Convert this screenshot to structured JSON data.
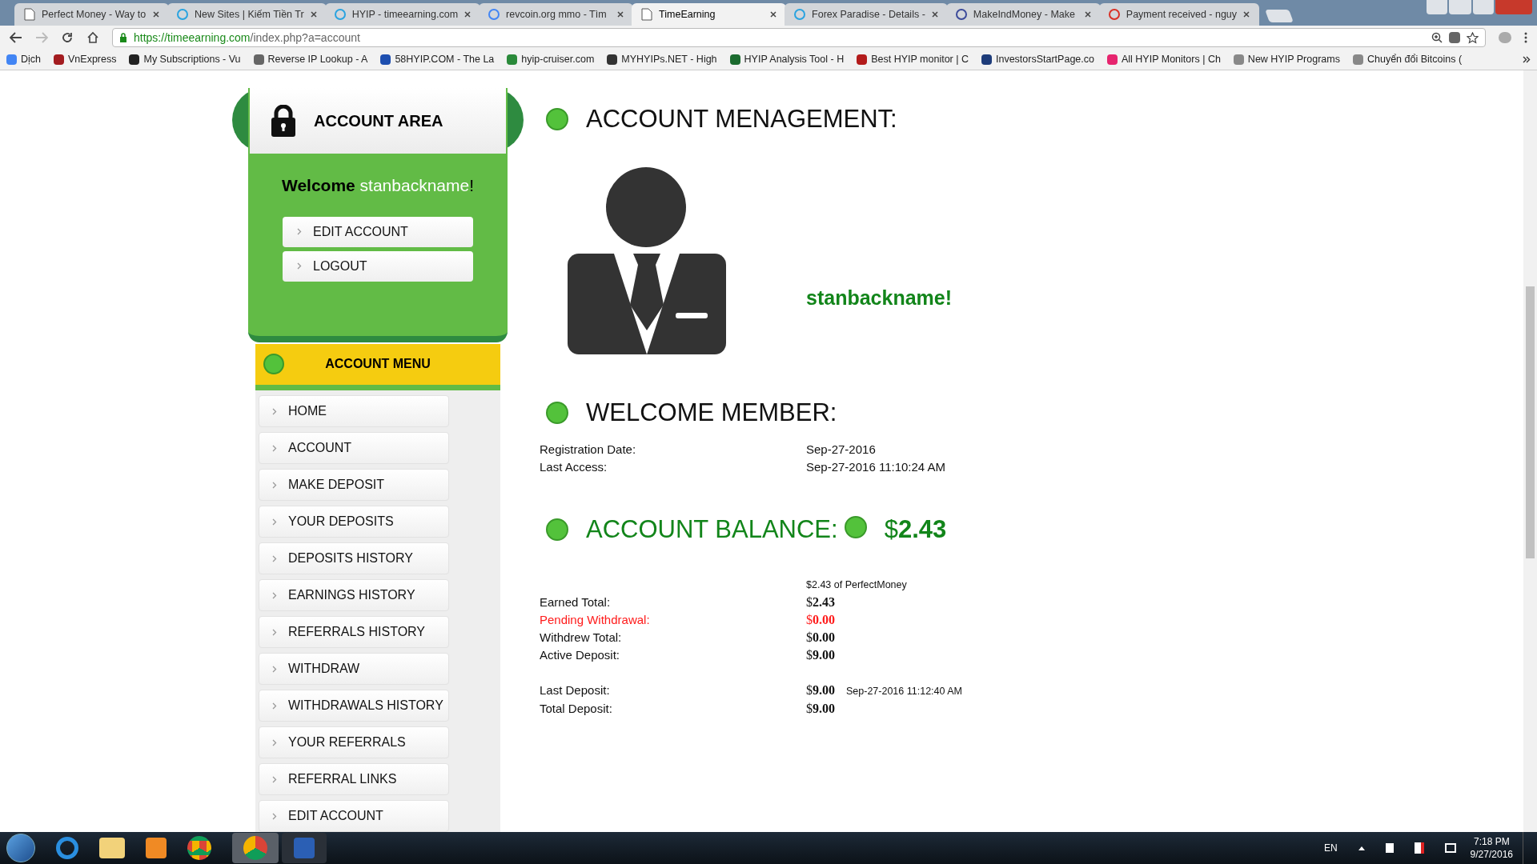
{
  "browser": {
    "tabs": [
      {
        "title": "Perfect Money - Way to",
        "selected": false
      },
      {
        "title": "New Sites | Kiếm Tiền Tr",
        "selected": false
      },
      {
        "title": "HYIP - timeearning.com",
        "selected": false
      },
      {
        "title": "revcoin.org mmo - Tìm",
        "selected": false
      },
      {
        "title": "TimeEarning",
        "selected": true
      },
      {
        "title": "Forex Paradise - Details -",
        "selected": false
      },
      {
        "title": "MakeIndMoney - Make",
        "selected": false
      },
      {
        "title": "Payment received - nguy",
        "selected": false
      }
    ],
    "address": {
      "host": "https://timeearning.com",
      "path": "/index.php?a=account"
    },
    "bookmarks": [
      {
        "label": "Dịch"
      },
      {
        "label": "VnExpress"
      },
      {
        "label": "My Subscriptions - Vu"
      },
      {
        "label": "Reverse IP Lookup - A"
      },
      {
        "label": "58HYIP.COM - The La"
      },
      {
        "label": "hyip-cruiser.com"
      },
      {
        "label": "MYHYIPs.NET - High"
      },
      {
        "label": "HYIP Analysis Tool - H"
      },
      {
        "label": "Best HYIP monitor | C"
      },
      {
        "label": "InvestorsStartPage.co"
      },
      {
        "label": "All HYIP Monitors | Ch"
      },
      {
        "label": "New HYIP Programs"
      },
      {
        "label": "Chuyển đổi Bitcoins ("
      }
    ]
  },
  "sidebar": {
    "account_area": {
      "title": "ACCOUNT AREA",
      "greeting": "Welcome",
      "username": "stanbackname",
      "punctuation": "!",
      "buttons": [
        "EDIT ACCOUNT",
        "LOGOUT"
      ]
    },
    "menu": {
      "title": "ACCOUNT MENU",
      "items": [
        "HOME",
        "ACCOUNT",
        "MAKE DEPOSIT",
        "YOUR DEPOSITS",
        "DEPOSITS HISTORY",
        "EARNINGS HISTORY",
        "REFERRALS HISTORY",
        "WITHDRAW",
        "WITHDRAWALS HISTORY",
        "YOUR REFERRALS",
        "REFERRAL LINKS",
        "EDIT ACCOUNT"
      ]
    }
  },
  "main": {
    "management": {
      "title": "ACCOUNT MENAGEMENT:",
      "username": "stanbackname!"
    },
    "welcome": {
      "title": "WELCOME MEMBER:",
      "rows": [
        {
          "label": "Registration Date:",
          "value": "Sep-27-2016"
        },
        {
          "label": "Last Access:",
          "value": "Sep-27-2016 11:10:24 AM"
        }
      ]
    },
    "balance": {
      "title": "ACCOUNT BALANCE:",
      "amount": "$**2.43**",
      "source": "$2.43 of PerfectMoney",
      "rows": [
        {
          "label": "Earned Total:",
          "value": "$**2.43**",
          "alert": false
        },
        {
          "label": "Pending Withdrawal:",
          "value": "$**0.00**",
          "alert": true
        },
        {
          "label": "Withdrew Total:",
          "value": "$**0.00**",
          "alert": false
        },
        {
          "label": "Active Deposit:",
          "value": "$**9.00**",
          "alert": false
        }
      ],
      "deposit_rows": [
        {
          "label": "Last Deposit:",
          "value": "$**9.00**",
          "date": "Sep-27-2016 11:12:40 AM"
        },
        {
          "label": "Total Deposit:",
          "value": "$**9.00**"
        }
      ]
    }
  },
  "taskbar": {
    "language": "EN",
    "time": "7:18 PM",
    "date": "9/27/2016"
  }
}
